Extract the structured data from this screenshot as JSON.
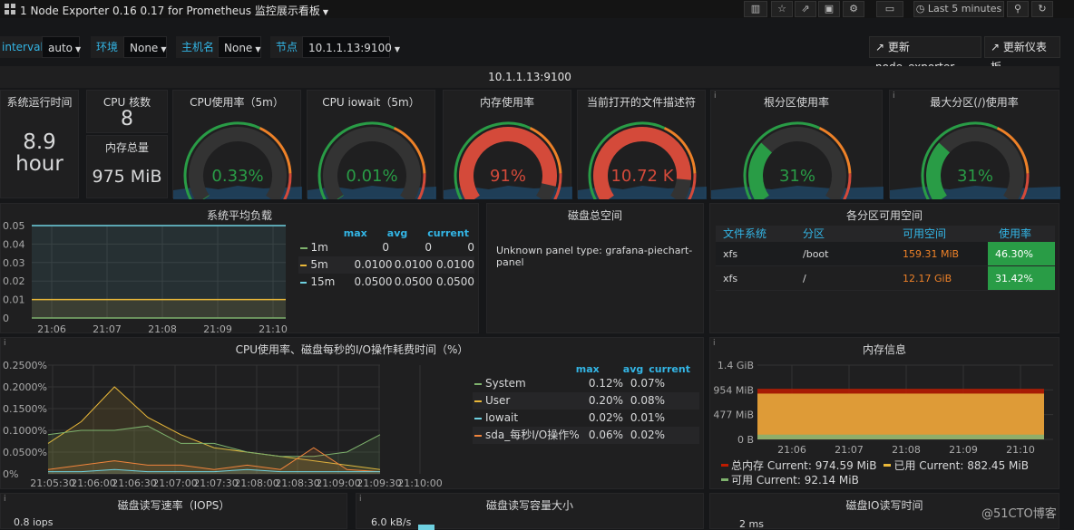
{
  "header": {
    "title": "1 Node Exporter 0.16 0.17 for Prometheus 监控展示看板",
    "time_range": "Last 5 minutes"
  },
  "vars": {
    "interval_label": "interval",
    "interval_value": "auto",
    "env_label": "环境",
    "env_value": "None",
    "host_label": "主机名",
    "host_value": "None",
    "node_label": "节点",
    "node_value": "10.1.1.13:9100"
  },
  "links": {
    "node_exporter": "更新node_exporter",
    "dashboard": "更新仪表板"
  },
  "row_title": "10.1.1.13:9100",
  "stats": {
    "uptime": {
      "title": "系统运行时间",
      "value": "8.9",
      "unit": "hour"
    },
    "cpu_cores": {
      "title": "CPU 核数",
      "value": "8"
    },
    "mem_total": {
      "title": "内存总量",
      "value": "975 MiB"
    }
  },
  "gauges": [
    {
      "title": "CPU使用率（5m）",
      "value": "0.33%",
      "fraction": 0.0033,
      "color": "#299c46"
    },
    {
      "title": "CPU iowait（5m）",
      "value": "0.01%",
      "fraction": 0.0001,
      "color": "#299c46"
    },
    {
      "title": "内存使用率",
      "value": "91%",
      "fraction": 0.91,
      "color": "#d44a3a"
    },
    {
      "title": "当前打开的文件描述符",
      "value": "10.72 K",
      "fraction": 0.88,
      "color": "#d44a3a"
    },
    {
      "title": "根分区使用率",
      "value": "31%",
      "fraction": 0.31,
      "color": "#299c46"
    },
    {
      "title": "最大分区(/)使用率",
      "value": "31%",
      "fraction": 0.31,
      "color": "#299c46"
    }
  ],
  "load_panel": {
    "title": "系统平均负载",
    "legend_headers": [
      "max",
      "avg",
      "current"
    ],
    "legend": [
      {
        "name": "1m",
        "color": "#7eb26d",
        "max": "0",
        "avg": "0",
        "current": "0"
      },
      {
        "name": "5m",
        "color": "#eab839",
        "max": "0.0100",
        "avg": "0.0100",
        "current": "0.0100"
      },
      {
        "name": "15m",
        "color": "#6ed0e0",
        "max": "0.0500",
        "avg": "0.0500",
        "current": "0.0500"
      }
    ],
    "yticks": [
      "0.05",
      "0.04",
      "0.03",
      "0.02",
      "0.01",
      "0"
    ],
    "xticks": [
      "21:06",
      "21:07",
      "21:08",
      "21:09",
      "21:10"
    ]
  },
  "disk_total": {
    "title": "磁盘总空间",
    "message": "Unknown panel type: grafana-piechart-panel"
  },
  "partition_table": {
    "title": "各分区可用空间",
    "headers": [
      "文件系统",
      "分区",
      "可用空间",
      "使用率"
    ],
    "rows": [
      {
        "fs": "xfs",
        "mount": "/boot",
        "avail": "159.31 MiB",
        "usage": "46.30%"
      },
      {
        "fs": "xfs",
        "mount": "/",
        "avail": "12.17 GiB",
        "usage": "31.42%"
      }
    ]
  },
  "cpu_panel": {
    "title": "CPU使用率、磁盘每秒的I/O操作耗费时间（%）",
    "legend_headers": [
      "max",
      "avg",
      "current"
    ],
    "yticks": [
      "0.2500%",
      "0.2000%",
      "0.1500%",
      "0.1000%",
      "0.0500%",
      "0%"
    ],
    "xticks": [
      "21:05:30",
      "21:06:00",
      "21:06:30",
      "21:07:00",
      "21:07:30",
      "21:08:00",
      "21:08:30",
      "21:09:00",
      "21:09:30",
      "21:10:00"
    ],
    "legend": [
      {
        "name": "System",
        "color": "#7eb26d",
        "max": "0.12%",
        "avg": "0.07%"
      },
      {
        "name": "User",
        "color": "#eab839",
        "max": "0.20%",
        "avg": "0.08%"
      },
      {
        "name": "Iowait",
        "color": "#6ed0e0",
        "max": "0.02%",
        "avg": "0.01%"
      },
      {
        "name": "sda_每秒I/O操作%",
        "color": "#ef843c",
        "max": "0.06%",
        "avg": "0.02%"
      }
    ]
  },
  "mem_panel": {
    "title": "内存信息",
    "yticks": [
      "1.4 GiB",
      "954 MiB",
      "477 MiB",
      "0 B"
    ],
    "xticks": [
      "21:06",
      "21:07",
      "21:08",
      "21:09",
      "21:10"
    ],
    "legend": [
      {
        "text": "总内存  Current: 974.59 MiB",
        "color": "#bf1b00"
      },
      {
        "text": "已用  Current: 882.45 MiB",
        "color": "#eab839"
      },
      {
        "text": "可用  Current: 92.14 MiB",
        "color": "#7eb26d"
      }
    ]
  },
  "bottom": {
    "iops_title": "磁盘读写速率（IOPS）",
    "iops_tick": "0.8 iops",
    "bytes_title": "磁盘读写容量大小",
    "bytes_tick": "6.0 kB/s",
    "iotime_title": "磁盘IO读写时间",
    "iotime_tick": "2 ms"
  },
  "watermark": "@51CTO博客"
}
